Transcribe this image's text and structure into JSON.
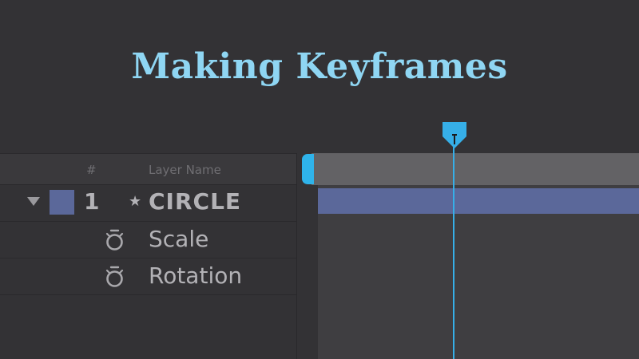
{
  "title": "Making Keyframes",
  "header": {
    "num_label": "#",
    "name_label": "Layer Name"
  },
  "layer": {
    "number": "1",
    "star": "★",
    "name": "CIRCLE",
    "color": "#5b689a"
  },
  "properties": [
    {
      "name": "Scale",
      "icon": "stopwatch-icon"
    },
    {
      "name": "Rotation",
      "icon": "stopwatch-icon"
    }
  ],
  "colors": {
    "accent": "#36afe8",
    "title": "#8fd6f3",
    "layer_bar": "#5b689a"
  }
}
